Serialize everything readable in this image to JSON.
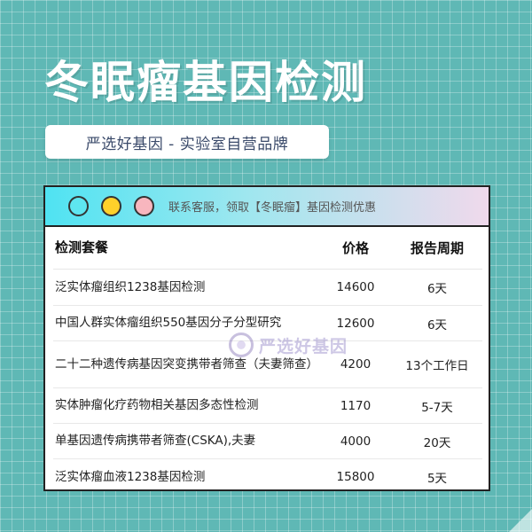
{
  "title": "冬眠瘤基因检测",
  "subtitle": "严选好基因 - 实验室自营品牌",
  "card": {
    "header_text": "联系客服，领取【冬眠瘤】基因检测优惠",
    "columns": [
      "检测套餐",
      "价格",
      "报告周期"
    ],
    "rows": [
      {
        "name": "泛实体瘤组织1238基因检测",
        "price": "14600",
        "period": "6天"
      },
      {
        "name": "中国人群实体瘤组织550基因分子分型研究",
        "price": "12600",
        "period": "6天"
      },
      {
        "name": "二十二种遗传病基因突变携带者筛查（夫妻筛查）",
        "price": "4200",
        "period": "13个工作日"
      },
      {
        "name": "实体肿瘤化疗药物相关基因多态性检测",
        "price": "1170",
        "period": "5-7天"
      },
      {
        "name": "单基因遗传病携带者筛查(CSKA),夫妻",
        "price": "4000",
        "period": "20天"
      },
      {
        "name": "泛实体瘤血液1238基因检测",
        "price": "15800",
        "period": "5天"
      }
    ]
  },
  "watermark": "严选好基因",
  "colors": {
    "background": "#5fb8b5",
    "header_gradient_start": "#4fe3f2",
    "header_gradient_end": "#f0d9ec",
    "dot_cyan": "#5ee6f0",
    "dot_yellow": "#ffd12a",
    "dot_pink": "#f8b6be"
  }
}
